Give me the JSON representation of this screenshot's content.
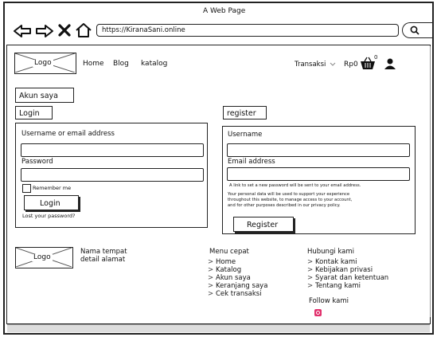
{
  "browser": {
    "window_title": "A Web Page",
    "url": "https://KiranaSani.online"
  },
  "header": {
    "logo_label": "Logo",
    "nav": [
      "Home",
      "Blog",
      "katalog"
    ],
    "transaksi_label": "Transaksi",
    "price": "Rp0",
    "cart_count": "0"
  },
  "account": {
    "title": "Akun saya"
  },
  "login": {
    "heading": "Login",
    "username_label": "Username or email address",
    "password_label": "Password",
    "remember_label": "Remember me",
    "button_label": "Login",
    "lost_password": "Lost your password?"
  },
  "register": {
    "heading": "register",
    "username_label": "Username",
    "email_label": "Email address",
    "note_1": "A link to set a new password will be sent to your email address.",
    "note_2_lines": [
      "Your personal data will be used to support your experience",
      "throughout this website, to manage access to your account,",
      "and for other purposes described in our privacy policy."
    ],
    "button_label": "Register"
  },
  "footer": {
    "logo_label": "Logo",
    "place_name": "Nama tempat",
    "address": "detail alamat",
    "menu_title": "Menu cepat",
    "menu_items": [
      "Home",
      "Katalog",
      "Akun saya",
      "Keranjang saya",
      "Cek transaksi"
    ],
    "contact_title": "Hubungi kami",
    "contact_items": [
      "Kontak kami",
      "Kebijakan privasi",
      "Syarat dan ketentuan",
      "Tentang kami"
    ],
    "follow_title": "Follow kami",
    "instagram_color": "#e1306c"
  }
}
